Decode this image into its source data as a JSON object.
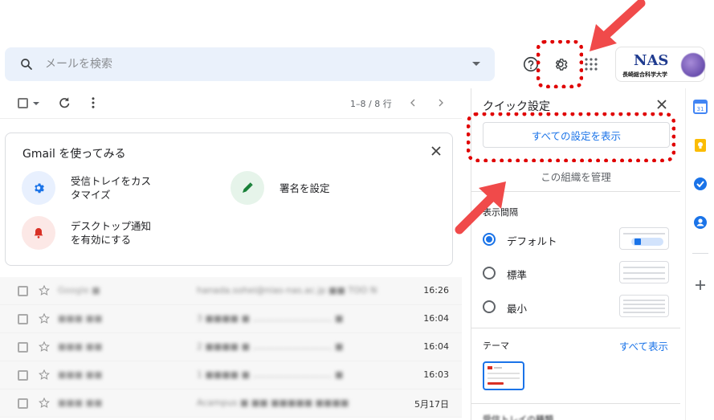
{
  "header": {
    "search_placeholder": "メールを検索",
    "help_icon": "help-icon",
    "settings_icon": "gear-icon",
    "apps_icon": "apps-grid-icon",
    "org_logo_text": "NAS",
    "org_logo_sub": "長崎総合科学大学"
  },
  "toolbar": {
    "pager": "1–8 / 8 行"
  },
  "onboarding": {
    "title": "Gmail を使ってみる",
    "tasks": [
      {
        "label": "受信トレイをカス\nタマイズ",
        "icon": "gear-icon",
        "color": "#e8f0fe"
      },
      {
        "label": "署名を設定",
        "icon": "pen-icon",
        "color": "#e6f4ea"
      },
      {
        "label": "デスクトップ通知\nを有効にする",
        "icon": "bell-icon",
        "color": "#fce8e6"
      }
    ]
  },
  "mails": [
    {
      "sender": "Google ■",
      "subject": "hanada.sohei@nias-nas.ac.jp ■■ TOO New",
      "time": "16:26"
    },
    {
      "sender": "■■■ ■■",
      "subject": "3 ■■■■ ■ ……………………… ■",
      "time": "16:04"
    },
    {
      "sender": "■■■ ■■",
      "subject": "2 ■■■■ ■ ……………………… ■",
      "time": "16:04"
    },
    {
      "sender": "■■■ ■■",
      "subject": "1 ■■■■ ■ ……………………… ■",
      "time": "16:03"
    },
    {
      "sender": "■■■ ■■",
      "subject": "Acampus ■ ■■ ■■■■■ ■■■■",
      "time": "5月17日"
    }
  ],
  "quick_settings": {
    "title": "クイック設定",
    "see_all_button": "すべての設定を表示",
    "manage_org": "この組織を管理",
    "density_label": "表示間隔",
    "density_options": [
      {
        "label": "デフォルト",
        "selected": true
      },
      {
        "label": "標準",
        "selected": false
      },
      {
        "label": "最小",
        "selected": false
      }
    ],
    "theme_label": "テーマ",
    "theme_see_all": "すべて表示",
    "inbox_type_label": "受信トレイの種類"
  },
  "side_panel": [
    "calendar-icon",
    "keep-icon",
    "tasks-icon",
    "contacts-icon",
    "add-icon"
  ],
  "colors": {
    "accent": "#1a73e8",
    "highlight": "#e00000",
    "arrow": "#f04a4a"
  }
}
